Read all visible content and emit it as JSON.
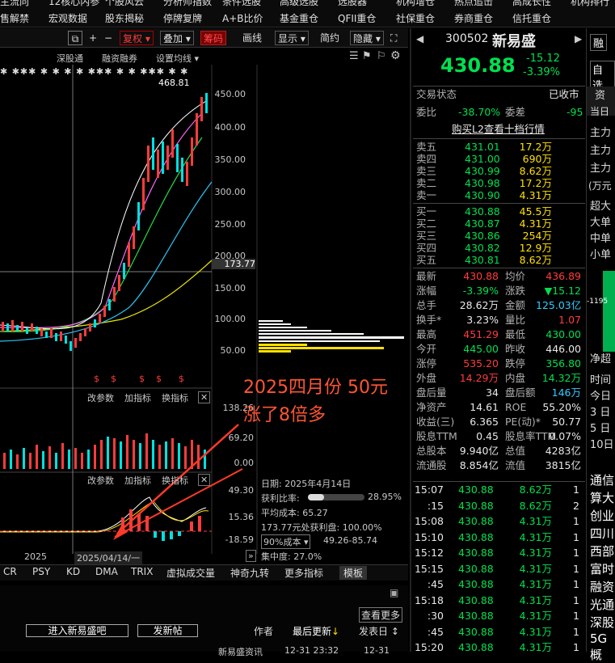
{
  "topnav": {
    "row1": [
      "主流向",
      "12核心内参",
      "个股风云",
      "分析师指数",
      "条件选股",
      "高级选股",
      "选股器",
      "机构增仓",
      "热点追击",
      "高成长性",
      "机构排行"
    ],
    "row2": [
      "售解禁",
      "宏观数据",
      "股东揭秘",
      "停牌复牌",
      "A+B比价",
      "基金重仓",
      "QFII重仓",
      "社保重仓",
      "券商重仓",
      "信托重仓"
    ]
  },
  "toolbar": {
    "fuquan": "复权",
    "diejia": "叠加",
    "chouma": "筹码",
    "huaxian": "画线",
    "xianshi": "显示",
    "jianyue": "简约",
    "yincang": "隐藏"
  },
  "chart_header": {
    "a": "深股通",
    "b": "融资融券",
    "c": "设置均线"
  },
  "price_axis": [
    "450.00",
    "400.00",
    "350.00",
    "300.00",
    "250.00",
    "200.00",
    "150.00",
    "100.00",
    "50.00"
  ],
  "high_marker": "468.81",
  "cursor_price": "173.77",
  "vol_panel": {
    "change": "改参数",
    "add": "加指标",
    "swap": "换指标",
    "axis": [
      "138.26",
      "69.20",
      "0.00"
    ]
  },
  "macd_panel": {
    "change": "改参数",
    "add": "加指标",
    "swap": "换指标",
    "axis": [
      "49.30",
      "15.36",
      "-18.59"
    ]
  },
  "date_axis": {
    "left": "2025",
    "cursor": "2025/04/14/一"
  },
  "chip_info": {
    "date": "日期: 2025年4月14日",
    "profit_label": "获利比率:",
    "profit_value": "28.95%",
    "avg_cost": "平均成本: 65.27",
    "profit_at": "173.77元处获利盘: 100.00%",
    "cost_select": "90%成本",
    "cost_range": "49.26-85.74",
    "concentration": "集中度: 27.0%",
    "profit_ratio": 0.2895
  },
  "annotation": {
    "line1": "2025四月份 50元",
    "line2": "涨了8倍多"
  },
  "bottom_tabs": [
    "CR",
    "PSY",
    "KD",
    "DMA",
    "TRIX",
    "虚拟成交量",
    "神奇九转",
    "更多指标",
    "模板"
  ],
  "bottom_bar": {
    "more": "查看更多",
    "enter": "进入新易盛吧",
    "post": "发新帖",
    "author": "作者",
    "latest": "最后更新",
    "posttime": "发表日",
    "row": "新易盛资讯",
    "t1": "12-31 23:32",
    "t2": "12-31"
  },
  "stock": {
    "code": "300502",
    "name": "新易盛",
    "price": "430.88",
    "change": "-15.12",
    "pct": "-3.39%",
    "margin": "融",
    "zixuan": "自选"
  },
  "status": {
    "label": "交易状态",
    "value": "已收市",
    "weibi_l": "委比",
    "weibi_v": "-38.70%",
    "weicha_l": "委差",
    "weicha_v": "-95",
    "l2": "购买L2查看十档行情"
  },
  "asks": [
    {
      "l": "卖五",
      "p": "431.01",
      "v": "17.2万"
    },
    {
      "l": "卖四",
      "p": "431.00",
      "v": "690万"
    },
    {
      "l": "卖三",
      "p": "430.99",
      "v": "8.62万"
    },
    {
      "l": "卖二",
      "p": "430.98",
      "v": "17.2万"
    },
    {
      "l": "卖一",
      "p": "430.90",
      "v": "4.31万"
    }
  ],
  "bids": [
    {
      "l": "买一",
      "p": "430.88",
      "v": "45.5万"
    },
    {
      "l": "买二",
      "p": "430.87",
      "v": "4.31万"
    },
    {
      "l": "买三",
      "p": "430.86",
      "v": "254万"
    },
    {
      "l": "买四",
      "p": "430.82",
      "v": "12.9万"
    },
    {
      "l": "买五",
      "p": "430.81",
      "v": "8.62万"
    }
  ],
  "stats": [
    {
      "l1": "最新",
      "v1": "430.88",
      "c1": "red",
      "l2": "均价",
      "v2": "436.89",
      "c2": "red"
    },
    {
      "l1": "涨幅",
      "v1": "-3.39%",
      "c1": "grn",
      "l2": "涨跌",
      "v2": "▼15.12",
      "c2": "grn"
    },
    {
      "l1": "总手",
      "v1": "28.62万",
      "c1": "wht",
      "l2": "金额",
      "v2": "125.03亿",
      "c2": "cyn"
    },
    {
      "l1": "换手*",
      "v1": "3.23%",
      "c1": "wht",
      "l2": "量比",
      "v2": "1.07",
      "c2": "red"
    },
    {
      "l1": "最高",
      "v1": "451.29",
      "c1": "red",
      "l2": "最低",
      "v2": "430.00",
      "c2": "grn"
    },
    {
      "l1": "今开",
      "v1": "445.00",
      "c1": "grn",
      "l2": "昨收",
      "v2": "446.00",
      "c2": "wht"
    },
    {
      "l1": "涨停",
      "v1": "535.20",
      "c1": "red",
      "l2": "跌停",
      "v2": "356.80",
      "c2": "grn"
    },
    {
      "l1": "外盘",
      "v1": "14.29万",
      "c1": "red",
      "l2": "内盘",
      "v2": "14.32万",
      "c2": "grn"
    },
    {
      "l1": "盘后量",
      "v1": "34",
      "c1": "wht",
      "l2": "盘后额",
      "v2": "146万",
      "c2": "cyn"
    },
    {
      "l1": "净资产",
      "v1": "14.61",
      "c1": "wht",
      "l2": "ROE",
      "v2": "55.20%",
      "c2": "wht"
    },
    {
      "l1": "收益(三)",
      "v1": "6.365",
      "c1": "wht",
      "l2": "PE(动)*",
      "v2": "50.77",
      "c2": "wht"
    },
    {
      "l1": "股息TTM",
      "v1": "0.45",
      "c1": "wht",
      "l2": "股息率TTM",
      "v2": "0.07%",
      "c2": "wht"
    },
    {
      "l1": "总股本",
      "v1": "9.940亿",
      "c1": "wht",
      "l2": "总值",
      "v2": "4283亿",
      "c2": "wht"
    },
    {
      "l1": "流通股",
      "v1": "8.854亿",
      "c1": "wht",
      "l2": "流值",
      "v2": "3815亿",
      "c2": "wht"
    }
  ],
  "ticks": [
    {
      "t": "15:07",
      "p": "430.88",
      "v": "8.62万",
      "n": "1"
    },
    {
      "t": ":15",
      "p": "430.88",
      "v": "8.62万",
      "n": "2"
    },
    {
      "t": "15:08",
      "p": "430.88",
      "v": "4.31万",
      "n": "1"
    },
    {
      "t": "15:10",
      "p": "430.88",
      "v": "4.31万",
      "n": "1"
    },
    {
      "t": "15:12",
      "p": "430.88",
      "v": "4.31万",
      "n": "1"
    },
    {
      "t": "15:15",
      "p": "430.88",
      "v": "4.31万",
      "n": "1"
    },
    {
      "t": ":45",
      "p": "430.88",
      "v": "4.31万",
      "n": "1"
    },
    {
      "t": "15:18",
      "p": "430.88",
      "v": "4.31万",
      "n": "1"
    },
    {
      "t": ":30",
      "p": "430.88",
      "v": "4.31万",
      "n": "1"
    },
    {
      "t": ":45",
      "p": "430.88",
      "v": "4.31万",
      "n": "1"
    },
    {
      "t": "15:20",
      "p": "430.88",
      "v": "4.31万",
      "n": "1"
    }
  ],
  "far_right": {
    "zijin": "资",
    "dangri": "当日",
    "zhuli": [
      "主力",
      "主力",
      "主力"
    ],
    "wanyuan": "(万元",
    "sizes": [
      "超大",
      "大单",
      "中单",
      "小单"
    ],
    "bar_label": "-1195",
    "jingliu": "净超",
    "time_rows": [
      "时间",
      "今日",
      "3 日",
      "5 日",
      "10日"
    ],
    "themes": [
      "通信",
      "算大",
      "创业",
      "四川",
      "西部",
      "富时",
      "融资",
      "光通",
      "深股",
      "5G概"
    ]
  },
  "colors": {
    "up": "#ff3c3c",
    "down": "#00e050",
    "bg": "#000000",
    "accent_yellow": "#ffe000",
    "cyan": "#33ccff"
  }
}
